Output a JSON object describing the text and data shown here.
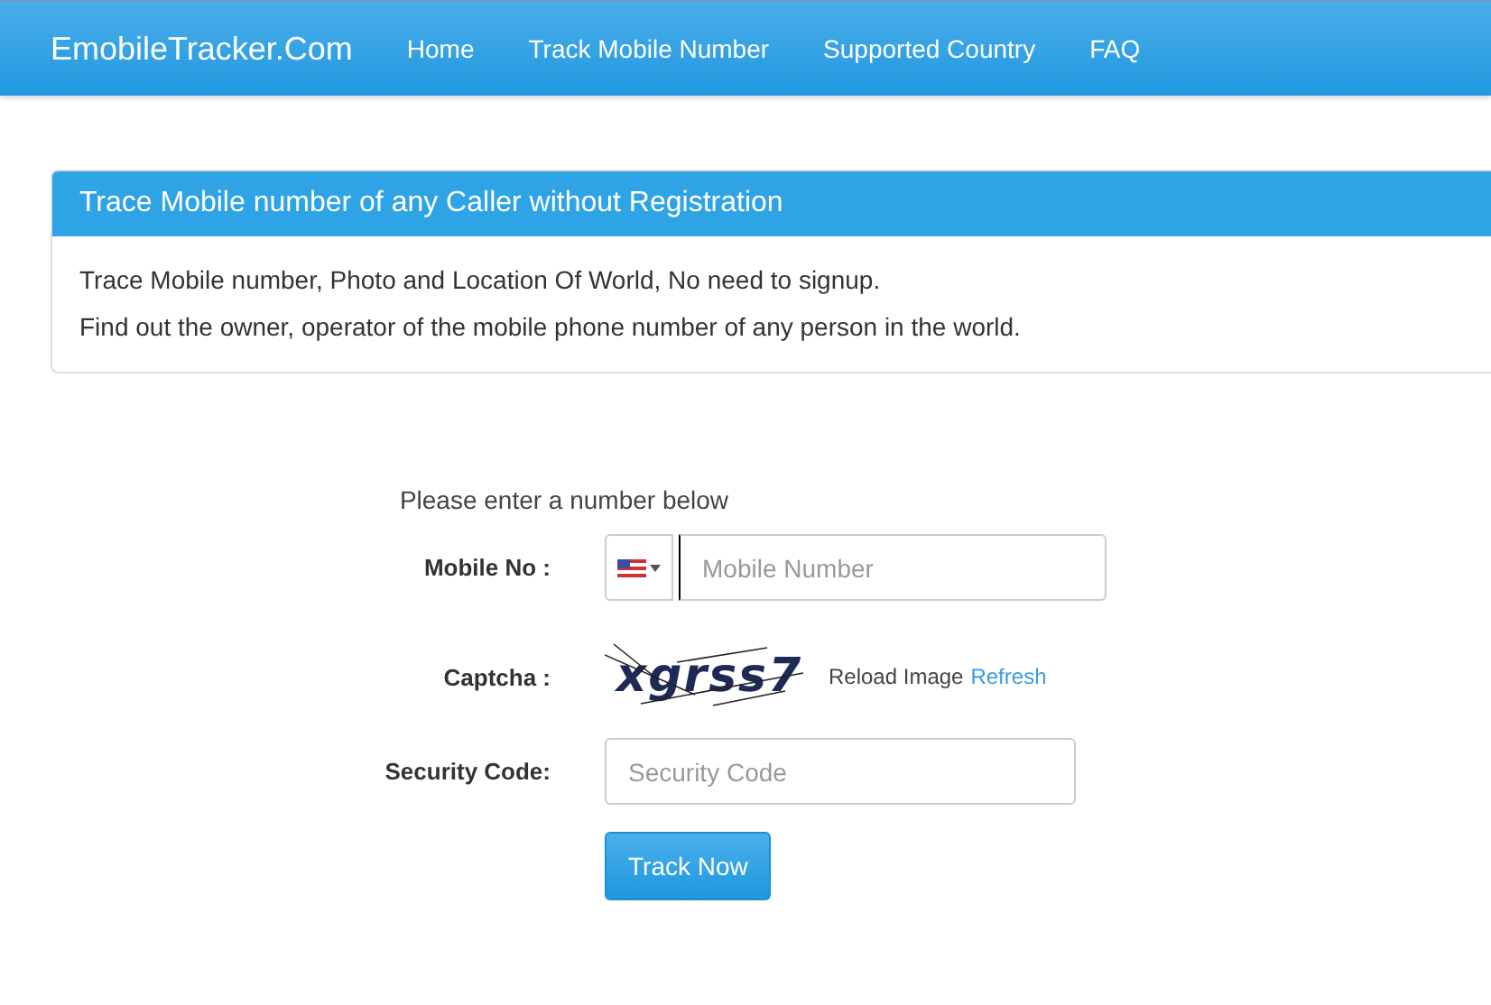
{
  "navbar": {
    "brand": "EmobileTracker.Com",
    "links": [
      {
        "label": "Home"
      },
      {
        "label": "Track Mobile Number"
      },
      {
        "label": "Supported Country"
      },
      {
        "label": "FAQ"
      }
    ]
  },
  "panel": {
    "title": "Trace Mobile number of any Caller without Registration",
    "lines": [
      "Trace Mobile number, Photo and Location Of World, No need to signup.",
      "Find out the owner, operator of the mobile phone number of any person in the world."
    ]
  },
  "form": {
    "intro": "Please enter a number below",
    "mobile": {
      "label": "Mobile No :",
      "placeholder": "Mobile Number"
    },
    "captcha": {
      "label": "Captcha :",
      "code": "xgrss7",
      "reload_text": "Reload Image",
      "refresh_link": "Refresh"
    },
    "security": {
      "label": "Security Code:",
      "placeholder": "Security Code"
    },
    "submit": "Track Now"
  }
}
